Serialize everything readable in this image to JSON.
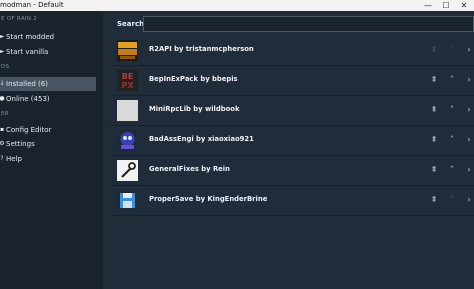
{
  "window": {
    "title": "modman - Default",
    "minimize": "—",
    "maximize": "☐",
    "close": "✕"
  },
  "sidebar": {
    "game_section": "E OF RAIN 2",
    "start_modded": {
      "icon": "►",
      "label": "Start modded"
    },
    "start_vanilla": {
      "icon": "►",
      "label": "Start vanilla"
    },
    "mods_section": "DS",
    "installed": {
      "icon": "↓",
      "label": "Installed (6)"
    },
    "online": {
      "icon": "●",
      "label": "Online (453)"
    },
    "other_section": "ER",
    "config_editor": {
      "icon": "▪",
      "label": "Config Editor"
    },
    "settings": {
      "icon": "⚙",
      "label": "Settings"
    },
    "help": {
      "icon": "?",
      "label": "Help"
    }
  },
  "search": {
    "label": "Search:",
    "value": "",
    "placeholder": ""
  },
  "mods": [
    {
      "name": "R2API by tristanmcpherson",
      "icon": "r2api-logo-icon"
    },
    {
      "name": "BepInExPack by bbepis",
      "icon": "bepinex-logo-icon"
    },
    {
      "name": "MiniRpcLib by wildbook",
      "icon": "placeholder-icon"
    },
    {
      "name": "BadAssEngi by xiaoxiao921",
      "icon": "engineer-icon"
    },
    {
      "name": "GeneralFixes by Rein",
      "icon": "wrench-icon"
    },
    {
      "name": "ProperSave by KingEnderBrine",
      "icon": "floppy-disk-icon"
    }
  ],
  "actions": {
    "move_top": "⇞",
    "move_up": "˄",
    "expand": "›"
  },
  "colors": {
    "background": "#212c3a",
    "sidebar": "#1a222d",
    "active_item": "#4a5563"
  }
}
